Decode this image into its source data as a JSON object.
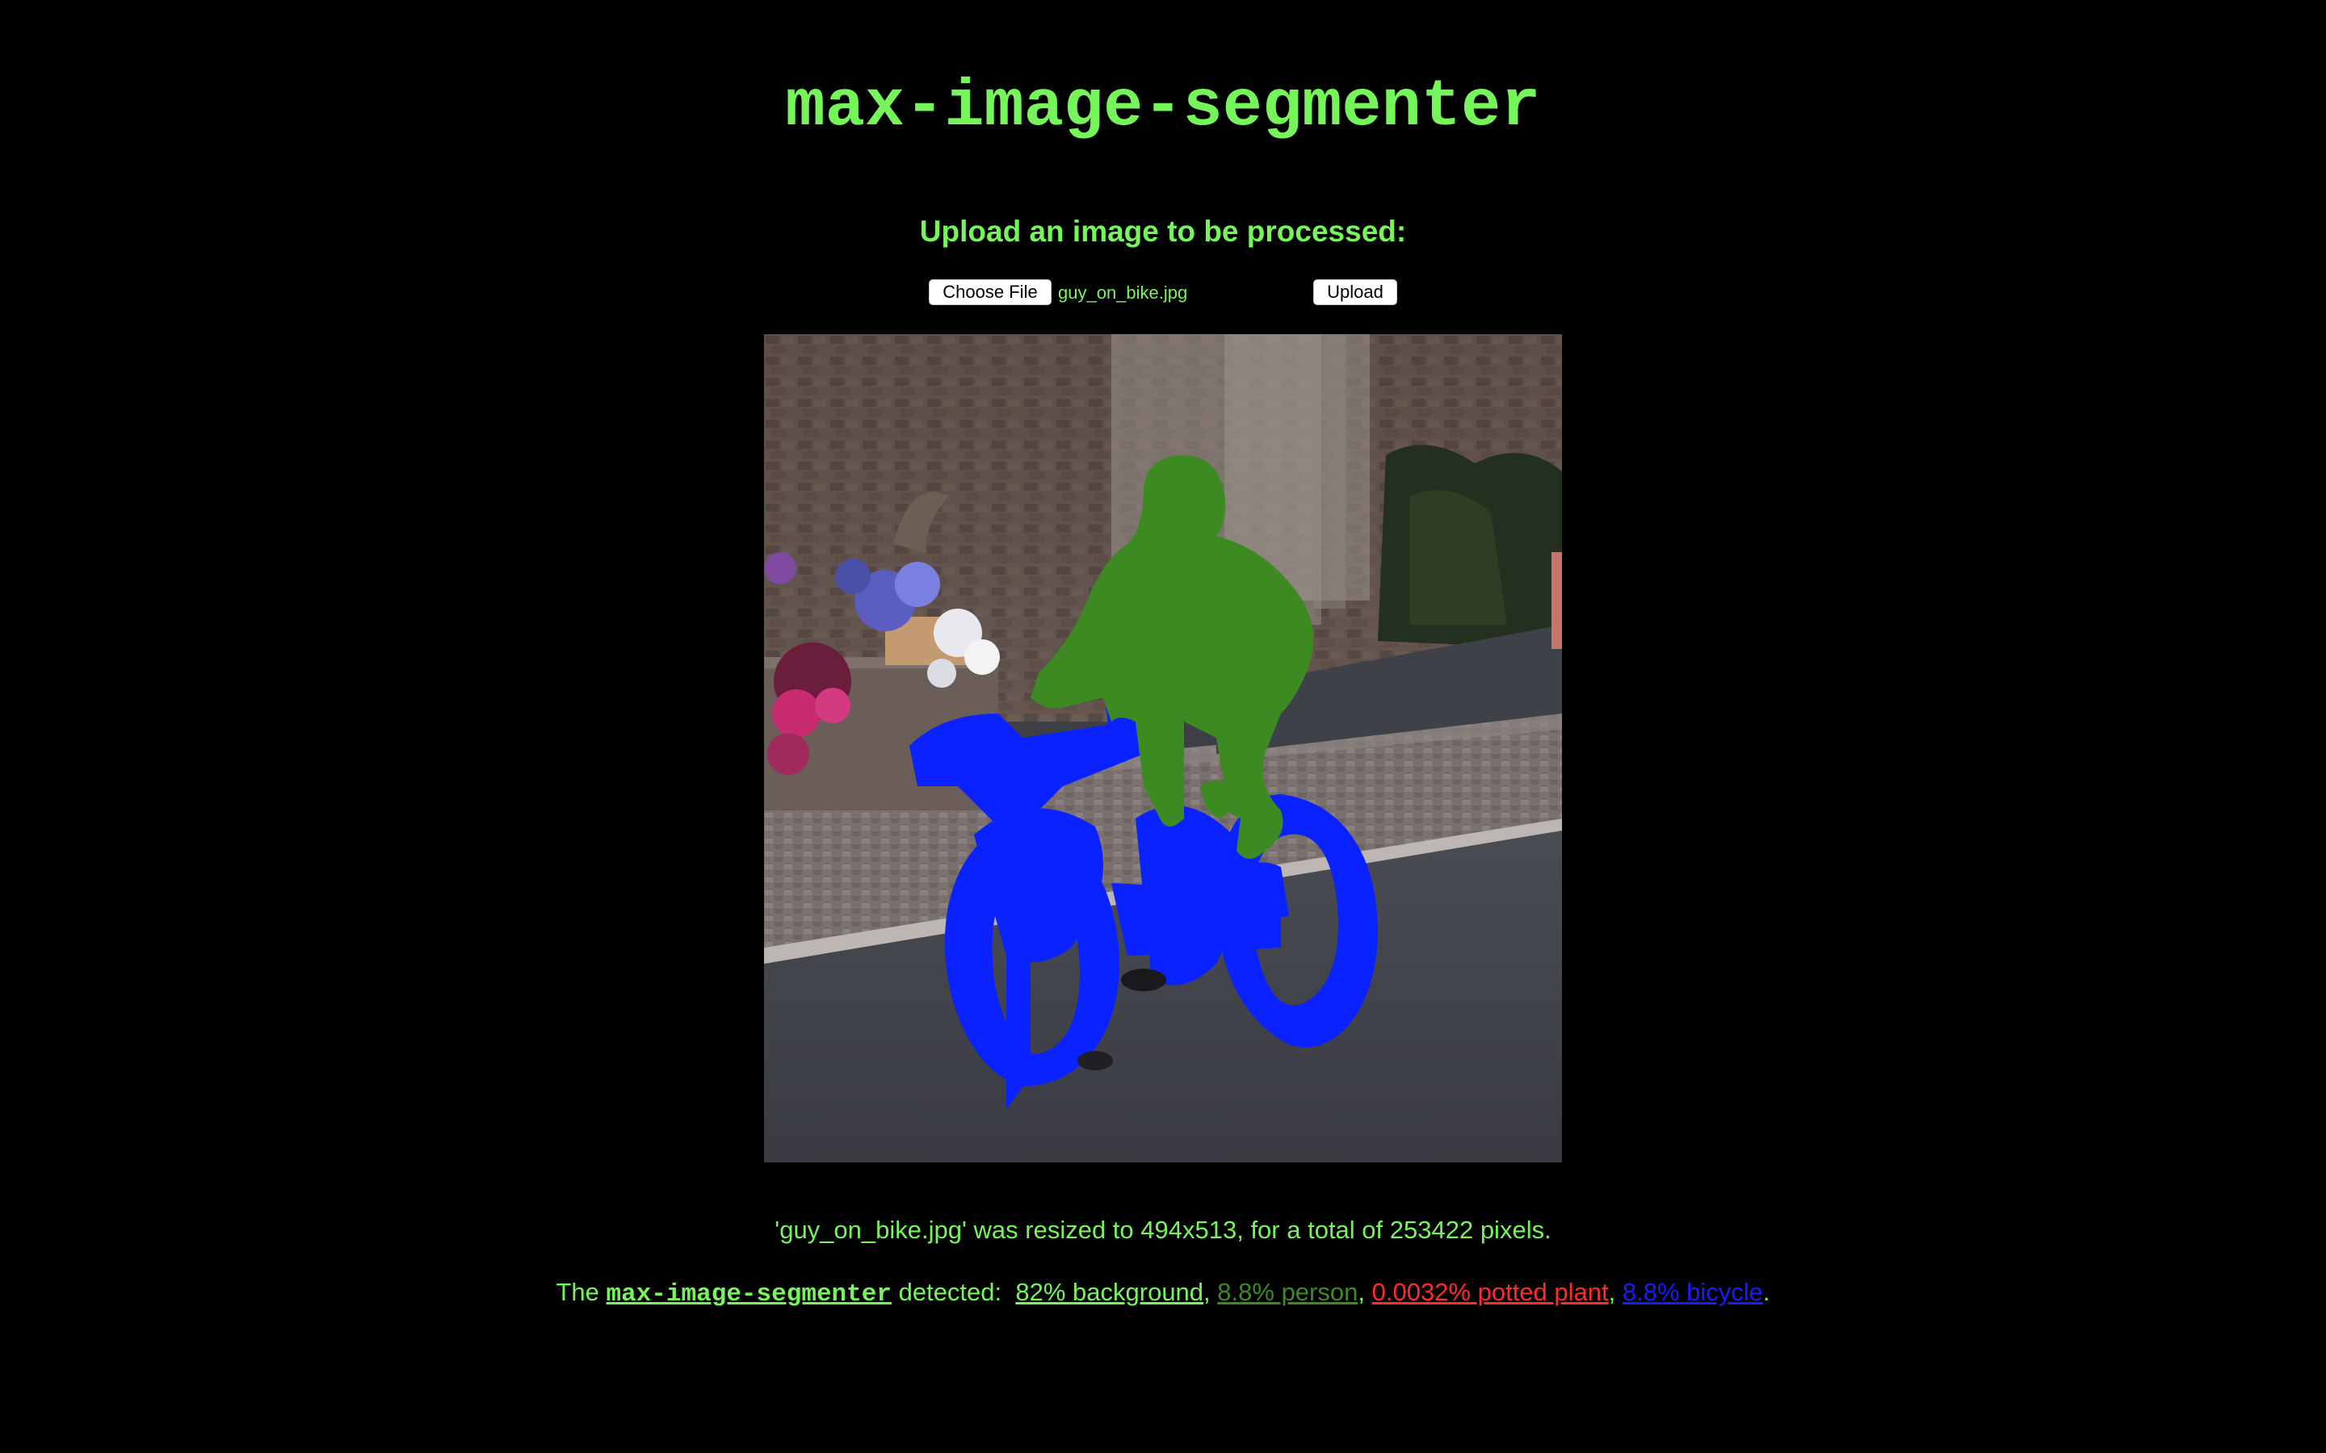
{
  "header": {
    "title": "max-image-segmenter"
  },
  "upload": {
    "heading": "Upload an image to be processed:",
    "choose_label": "Choose File",
    "file_name": "guy_on_bike.jpg",
    "upload_label": "Upload"
  },
  "result": {
    "resize_message": "'guy_on_bike.jpg' was resized to 494x513, for a total of 253422 pixels.",
    "detect_prefix": "The",
    "model_link": "max-image-segmenter",
    "detect_middle": "detected:",
    "classes": [
      {
        "label": "82% background",
        "color": "#76f55a",
        "sep": ","
      },
      {
        "label": "8.8% person",
        "color": "#3e8a22",
        "sep": ","
      },
      {
        "label": "0.0032% potted plant",
        "color": "#ff2b2b",
        "sep": ","
      },
      {
        "label": "8.8% bicycle",
        "color": "#1a1aff",
        "sep": "."
      }
    ]
  },
  "colors": {
    "text_accent": "#76f55a",
    "background": "#000000",
    "person_mask": "#3e8a22",
    "bicycle_mask": "#0a22ff"
  }
}
